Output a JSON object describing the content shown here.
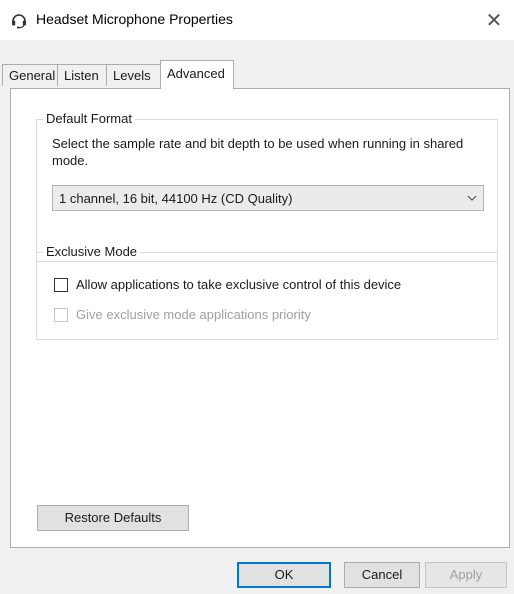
{
  "window": {
    "title": "Headset Microphone Properties",
    "close_glyph": "✕"
  },
  "tabs": [
    {
      "label": "General"
    },
    {
      "label": "Listen"
    },
    {
      "label": "Levels"
    },
    {
      "label": "Advanced",
      "active": true
    }
  ],
  "default_format": {
    "group_title": "Default Format",
    "description": "Select the sample rate and bit depth to be used when running in shared mode.",
    "selected_value": "1 channel, 16 bit, 44100 Hz (CD Quality)"
  },
  "exclusive_mode": {
    "group_title": "Exclusive Mode",
    "allow_exclusive_label": "Allow applications to take exclusive control of this device",
    "allow_exclusive_checked": false,
    "priority_label": "Give exclusive mode applications priority",
    "priority_checked": false,
    "priority_enabled": false
  },
  "buttons": {
    "restore_defaults": "Restore Defaults",
    "ok": "OK",
    "cancel": "Cancel",
    "apply": "Apply"
  },
  "colors": {
    "accent": "#0078d7",
    "disabled_text": "#a0a0a0"
  },
  "icons": {
    "title": "headset-icon",
    "close": "close-icon",
    "dropdown": "chevron-down-icon"
  }
}
